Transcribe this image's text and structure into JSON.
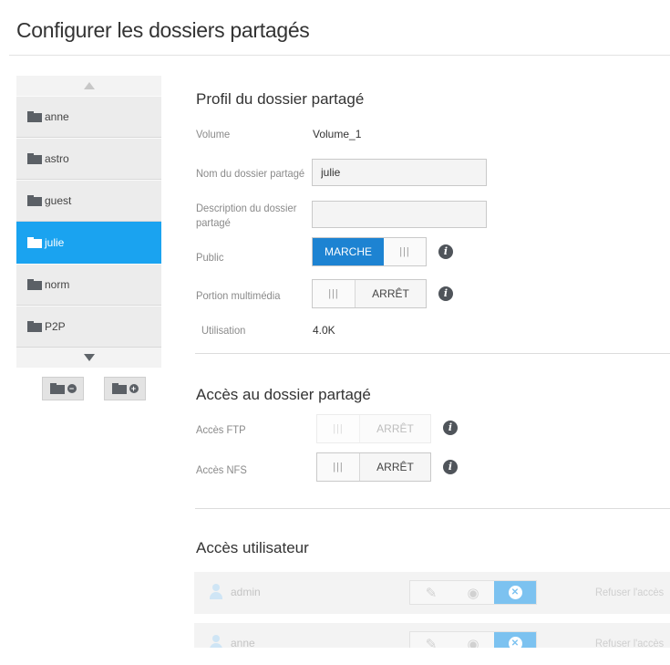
{
  "page": {
    "title": "Configurer les dossiers partagés"
  },
  "sidebar": {
    "folders": [
      {
        "name": "anne"
      },
      {
        "name": "astro"
      },
      {
        "name": "guest"
      },
      {
        "name": "julie",
        "selected": true
      },
      {
        "name": "norm"
      },
      {
        "name": "P2P"
      }
    ],
    "icons": {
      "scroll_up": "triangle-up-icon",
      "scroll_down": "triangle-down-icon",
      "remove": "folder-remove-icon",
      "add": "folder-add-icon"
    }
  },
  "profile": {
    "title": "Profil du dossier partagé",
    "volume_label": "Volume",
    "volume_value": "Volume_1",
    "name_label": "Nom du dossier partagé",
    "name_value": "julie",
    "description_label": "Description du dossier partagé",
    "description_value": "",
    "public_label": "Public",
    "public_state": "MARCHE",
    "media_label": "Portion multimédia",
    "media_state": "ARRÊT",
    "usage_label": "Utilisation",
    "usage_value": "4.0K",
    "toggle_grip": "|||"
  },
  "access": {
    "title": "Accès au dossier partagé",
    "ftp_label": "Accès FTP",
    "ftp_state": "ARRÊT",
    "nfs_label": "Accès NFS",
    "nfs_state": "ARRÊT"
  },
  "users": {
    "title": "Accès utilisateur",
    "rows": [
      {
        "name": "admin",
        "status": "Refuser l'accès"
      },
      {
        "name": "anne",
        "status": "Refuser l'accès"
      }
    ]
  },
  "colors": {
    "accent": "#1aa3f0",
    "toggle_on": "#1d83d2",
    "deny_active": "#7cc2f0"
  }
}
